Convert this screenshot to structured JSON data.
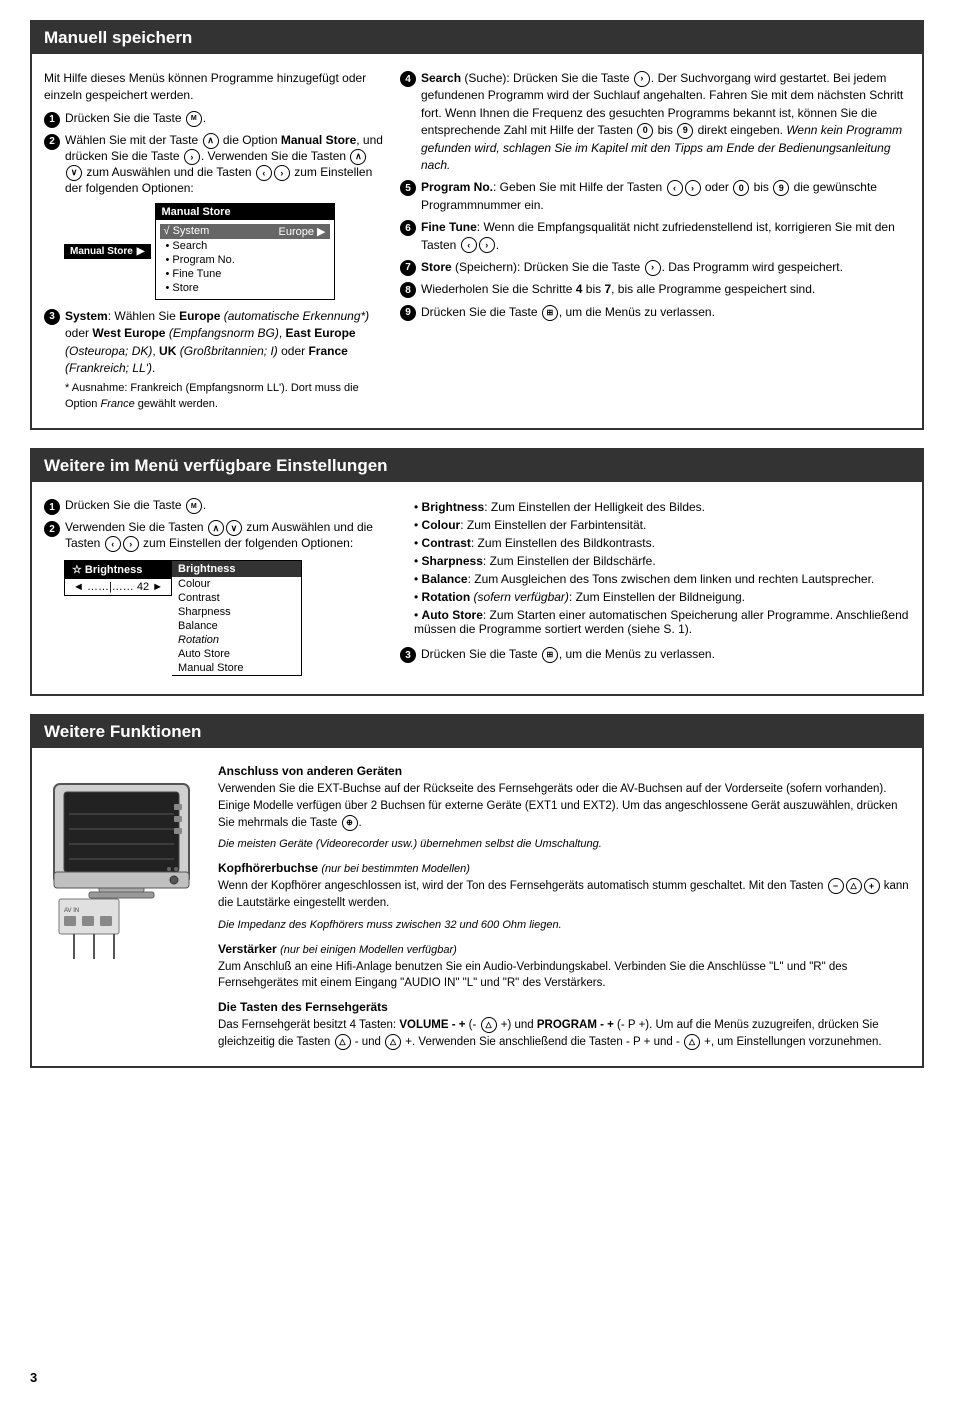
{
  "page_number": "3",
  "section1": {
    "title": "Manuell speichern",
    "intro": "Mit Hilfe dieses Menüs können Programme hinzugefügt oder einzeln gespeichert werden.",
    "steps_left": [
      {
        "num": "1",
        "text": "Drücken Sie die Taste [MENU]."
      },
      {
        "num": "2",
        "text": "Wählen Sie mit der Taste [UP] die Option Manual Store, und drücken Sie die Taste [RIGHT]. Verwenden Sie die Tasten [UP][DOWN] zum Auswählen und die Tasten [LEFT][RIGHT] zum Einstellen der folgenden Optionen:"
      }
    ],
    "menu": {
      "tab": "Manual Store",
      "header": "Manual Store",
      "system_row": "√ System",
      "system_val": "Europe ▶",
      "items": [
        "• Search",
        "• Program No.",
        "• Fine Tune",
        "• Store"
      ]
    },
    "step3": {
      "num": "3",
      "text": "System: Wählen Sie Europe (automatische Erkennung*) oder West Europe (Empfangsnorm BG), East Europe (Osteuropa; DK), UK (Großbritannien; I) oder France (Frankreich; LL').",
      "note": "* Ausnahme: Frankreich (Empfangsnorm LL'). Dort muss die Option France gewählt werden."
    },
    "steps_right": [
      {
        "num": "4",
        "label": "Search",
        "text": "(Suche): Drücken Sie die Taste [RIGHT]. Der Suchvorgang wird gestartet. Bei jedem gefundenen Programm wird der Suchlauf angehalten. Fahren Sie mit dem nächsten Schritt fort. Wenn Ihnen die Frequenz des gesuchten Programms bekannt ist, können Sie die entsprechende Zahl mit Hilfe der Tasten [0] bis [9] direkt eingeben.",
        "italic": "Wenn kein Programm gefunden wird, schlagen Sie im Kapitel mit den Tipps am Ende der Bedienungsanleitung nach."
      },
      {
        "num": "5",
        "label": "Program No.",
        "text": ": Geben Sie mit Hilfe der Tasten [LEFT][RIGHT] oder [0] bis [9] die gewünschte Programmnummer ein."
      },
      {
        "num": "6",
        "label": "Fine Tune",
        "text": ": Wenn die Empfangsqualität nicht zufriedenstellend ist, korrigieren Sie mit den Tasten [LEFT][RIGHT]."
      },
      {
        "num": "7",
        "label": "Store",
        "text": "(Speichern): Drücken Sie die Taste [RIGHT]. Das Programm wird gespeichert."
      },
      {
        "num": "8",
        "text": "Wiederholen Sie die Schritte 4 bis 7, bis alle Programme gespeichert sind."
      },
      {
        "num": "9",
        "text": "Drücken Sie die Taste [MENU2], um die Menüs zu verlassen."
      }
    ]
  },
  "section2": {
    "title": "Weitere im Menü verfügbare Einstellungen",
    "steps_left": [
      {
        "num": "1",
        "text": "Drücken Sie die Taste [MENU]."
      },
      {
        "num": "2",
        "text": "Verwenden Sie die Tasten [UP][DOWN] zum Auswählen und die Tasten [LEFT][RIGHT] zum Einstellen der folgenden Optionen:"
      }
    ],
    "menu": {
      "tab": "☆ Brightness",
      "slider": "◄ ……|…… 42 ►",
      "items": [
        "Brightness",
        "Colour",
        "Contrast",
        "Sharpness",
        "Balance",
        "Rotation",
        "Auto Store",
        "Manual Store"
      ]
    },
    "bullets": [
      {
        "label": "Brightness",
        "text": ": Zum Einstellen der Helligkeit des Bildes."
      },
      {
        "label": "Colour",
        "text": ": Zum Einstellen der Farbintensität."
      },
      {
        "label": "Contrast",
        "text": ": Zum Einstellen des Bildkontrasts."
      },
      {
        "label": "Sharpness",
        "text": ": Zum Einstellen der Bildschärfe."
      },
      {
        "label": "Balance",
        "text": ": Zum Ausgleichen des Tons zwischen dem linken und rechten Lautsprecher."
      },
      {
        "label": "Rotation",
        "italic_extra": "(sofern verfügbar)",
        "text": ": Zum Einstellen der Bildneigung."
      },
      {
        "label": "Auto Store",
        "text": ": Zum Starten einer automatischen Speicherung aller Programme. Anschließend müssen die Programme sortiert werden (siehe S. 1)."
      }
    ],
    "step3": {
      "num": "3",
      "text": "Drücken Sie die Taste [MENU2], um die Menüs zu verlassen."
    }
  },
  "section3": {
    "title": "Weitere Funktionen",
    "subsections": [
      {
        "id": "anschluss",
        "title": "Anschluss von anderen Geräten",
        "text": "Verwenden Sie die EXT-Buchse auf der Rückseite des Fernsehgeräts oder die AV-Buchsen auf der Vorderseite (sofern vorhanden). Einige Modelle verfügen über 2 Buchsen für externe Geräte (EXT1 und EXT2). Um das angeschlossene Gerät auszuwählen, drücken Sie mehrmals die Taste [SOURCE].",
        "italic": "Die meisten Geräte (Videorecorder usw.) übernehmen selbst die Umschaltung."
      },
      {
        "id": "kopfhoerer",
        "title": "Kopfhörerbuchse",
        "title_note": "(nur bei bestimmten Modellen)",
        "text": "Wenn der Kopfhörer angeschlossen ist, wird der Ton des Fernsehgeräts automatisch stumm geschaltet. Mit den Tasten [MINUS][VOL+] kann die Lautstärke eingestellt werden.",
        "italic": "Die Impedanz des Kopfhörers muss zwischen 32 und 600 Ohm liegen."
      },
      {
        "id": "verstaerker",
        "title": "Verstärker",
        "title_note": "(nur bei einigen Modellen verfügbar)",
        "text": "Zum Anschluß an eine Hifi-Anlage benutzen Sie ein Audio-Verbindungskabel. Verbinden Sie die Anschlüsse \"L\" und \"R\" des Fernsehgerätes mit einem Eingang \"AUDIO IN\" \"L\" und \"R\" des Verstärkers."
      },
      {
        "id": "tasten",
        "title": "Die Tasten des Fernsehgeräts",
        "text": "Das Fernsehgerät besitzt 4 Tasten: VOLUME - + (- [VOL] +) und PROGRAM - + (- P +). Um auf die Menüs zuzugreifen, drücken Sie gleichzeitig die Tasten [VOL] - und [VOL] +. Verwenden Sie anschließend die Tasten - P + und - [VOL] +, um Einstellungen vorzunehmen."
      }
    ]
  }
}
